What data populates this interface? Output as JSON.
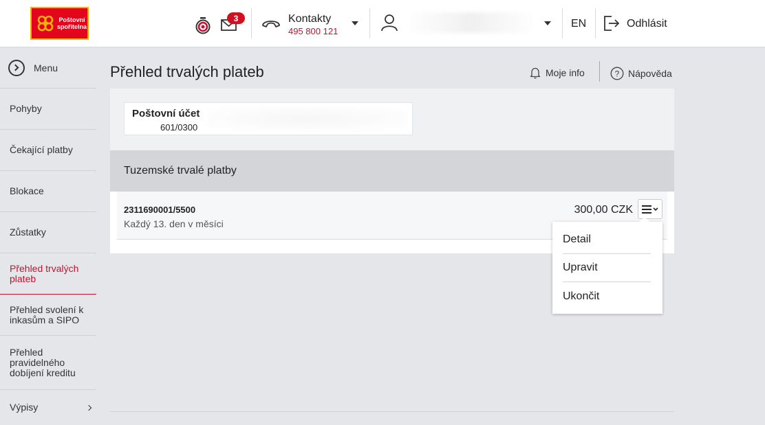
{
  "brand": {
    "logo_line1": "Poštovní",
    "logo_line2": "spořitelna",
    "primary_color": "#c8102e",
    "logo_background": "#e3051b",
    "logo_border": "#f7b500"
  },
  "header": {
    "mail_badge_count": "3",
    "contacts_label": "Kontakty",
    "contacts_phone": "495 800 121",
    "language": "EN",
    "logout_label": "Odhlásit",
    "icons": [
      "timer-icon",
      "mail-icon",
      "phone-icon",
      "user-icon",
      "logout-icon"
    ]
  },
  "sidebar": {
    "menu_label": "Menu",
    "items": [
      {
        "label": "Pohyby"
      },
      {
        "label": "Čekající platby"
      },
      {
        "label": "Blokace"
      },
      {
        "label": "Zůstatky"
      },
      {
        "label": "Přehled trvalých plateb",
        "active": true
      },
      {
        "label": "Přehled svolení k inkasům a SIPO"
      },
      {
        "label": "Přehled pravidelného dobíjení kreditu"
      },
      {
        "label": "Výpisy",
        "has_submenu": true
      }
    ]
  },
  "main": {
    "title": "Přehled trvalých plateb",
    "my_info": "Moje info",
    "help": "Nápověda",
    "account": {
      "name": "Poštovní účet",
      "number": "601/0300"
    },
    "section_title": "Tuzemské trvalé platby",
    "payments": [
      {
        "account": "2311690001/5500",
        "frequency": "Každý 13. den v měsíci",
        "amount": "300,00 CZK"
      }
    ],
    "dropdown": {
      "items": [
        "Detail",
        "Upravit",
        "Ukončit"
      ]
    }
  }
}
